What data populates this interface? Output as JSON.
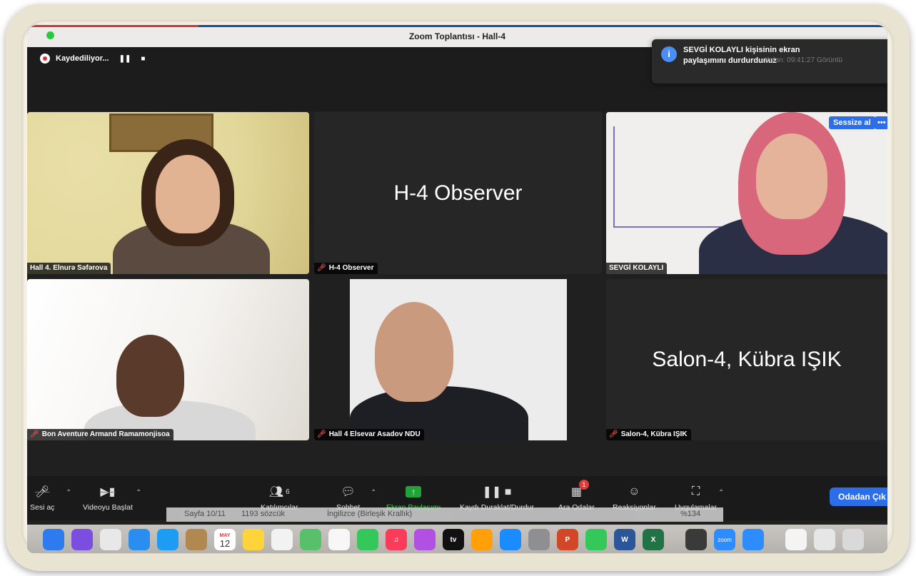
{
  "window": {
    "title": "Zoom Toplantısı - Hall-4"
  },
  "recording": {
    "label": "Kaydediliyor...",
    "pause_icon": "pause-icon",
    "stop_icon": "stop-icon"
  },
  "notification": {
    "text": "SEVGİ KOLAYLI kişisinin ekran paylaşımını durdurdunuz",
    "meta": "Kalan: 09:41:27   Görüntü"
  },
  "tiles": [
    {
      "name": "Hall 4. Elnurə Səfərova",
      "muted": false,
      "video": true
    },
    {
      "name": "H-4 Observer",
      "big_label": "H-4 Observer",
      "muted": true,
      "video": false
    },
    {
      "name": "SEVGİ KOLAYLI",
      "muted": false,
      "video": true,
      "active_speaker": true,
      "hover_button": "Sessize al",
      "more": "•••"
    },
    {
      "name": "Bon Aventure Armand Ramamonjisoa",
      "muted": true,
      "video": true
    },
    {
      "name": "Hall 4 Elsevar Asadov NDU",
      "muted": true,
      "video": true
    },
    {
      "name": "Salon-4, Kübra IŞIK",
      "big_label": "Salon-4, Kübra IŞIK",
      "muted": true,
      "video": false
    }
  ],
  "toolbar": {
    "unmute": "Sesi aç",
    "start_video": "Videoyu Başlat",
    "participants": "Katılımcılar",
    "participants_count": "6",
    "chat": "Sohbet",
    "share_screen": "Ekran Paylaşımı",
    "recording_control": "Kaydı Duraklat/Durdur",
    "breakout": "Ara Odalar",
    "breakout_badge": "1",
    "reactions": "Reaksiyonlar",
    "apps": "Uygulamalar",
    "leave": "Odadan Çık"
  },
  "word_status": {
    "page": "Sayfa 10/11",
    "words": "1193 sözcük",
    "language": "İngilizce (Birleşik Krallık)",
    "zoom": "%134"
  },
  "dock": {
    "calendar_month": "MAY",
    "calendar_day": "12",
    "tv": "tv",
    "zoom": "zoom"
  },
  "colors": {
    "accent_blue": "#2b6ee8",
    "active_green": "#5fcf6f",
    "share_green": "#22a33a",
    "muted_red": "#e04b4b"
  }
}
